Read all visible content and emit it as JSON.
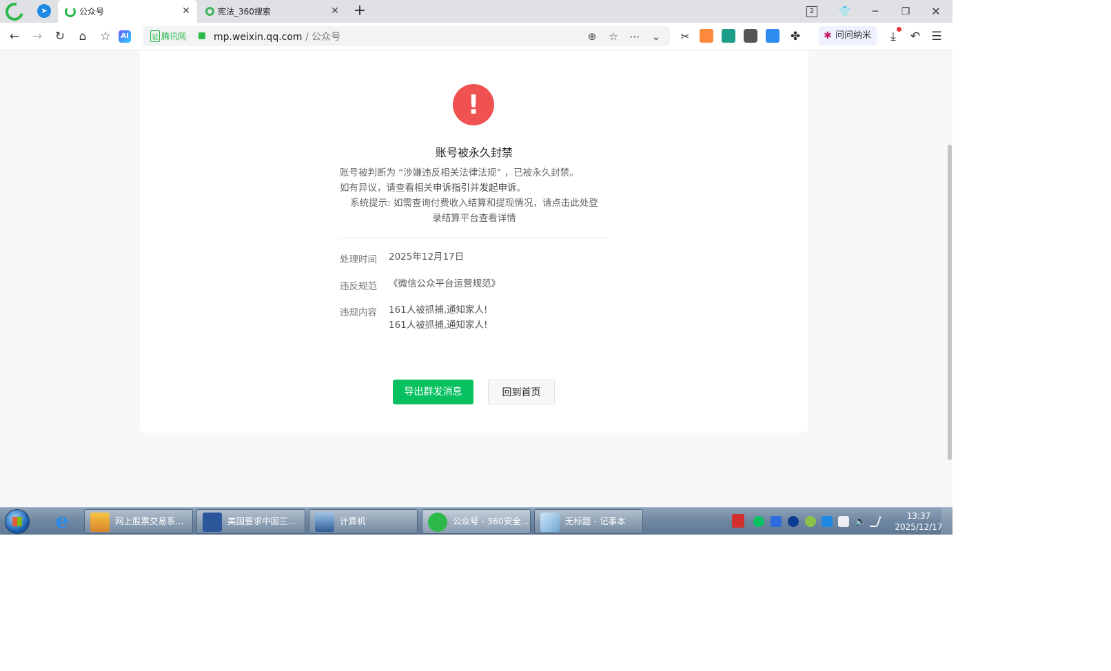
{
  "browser": {
    "tabs": [
      {
        "label": "公众号",
        "active": true
      },
      {
        "label": "宪法_360搜索",
        "active": false
      }
    ],
    "new_tab": "+",
    "window_counter": "2",
    "address": {
      "cert_box": "证",
      "cert_label": "腾讯网",
      "host": "mp.weixin.qq.com",
      "path": " / 公众号"
    },
    "extensions": {
      "wenwen_label": "问问纳米"
    }
  },
  "page": {
    "title": "账号被永久封禁",
    "desc_line1": "账号被判断为 “涉嫌违反相关法律法规” ，已被永久封禁。",
    "desc_line2_prefix": "如有异议，请查看相关",
    "desc_line2_link1": "申诉指引",
    "desc_line2_mid": "并",
    "desc_line2_link2": "发起申诉",
    "desc_line2_suffix": "。",
    "desc_line3a": "系统提示: 如需查询付费收入结算和提现情况，请点击此处登",
    "desc_line3b": "录结算平台查看详情",
    "details": [
      {
        "label": "处理时间",
        "value": "2025年12月17日"
      },
      {
        "label": "违反规范",
        "value": "《微信公众平台运营规范》"
      },
      {
        "label": "违规内容",
        "value": "161人被抓捕,通知家人!",
        "value2": "161人被抓捕,通知家人!"
      }
    ],
    "buttons": {
      "export": "导出群发消息",
      "home": "回到首页"
    },
    "colors": {
      "primary": "#07c160",
      "warning": "#f05151"
    }
  },
  "taskbar": {
    "items": [
      {
        "label": "网上股票交易系..."
      },
      {
        "label": "美国要求中国三..."
      },
      {
        "label": "计算机"
      },
      {
        "label": "公众号 - 360安全..."
      },
      {
        "label": "无标题 - 记事本"
      }
    ],
    "clock": {
      "time": "13:37",
      "date": "2025/12/17"
    }
  }
}
